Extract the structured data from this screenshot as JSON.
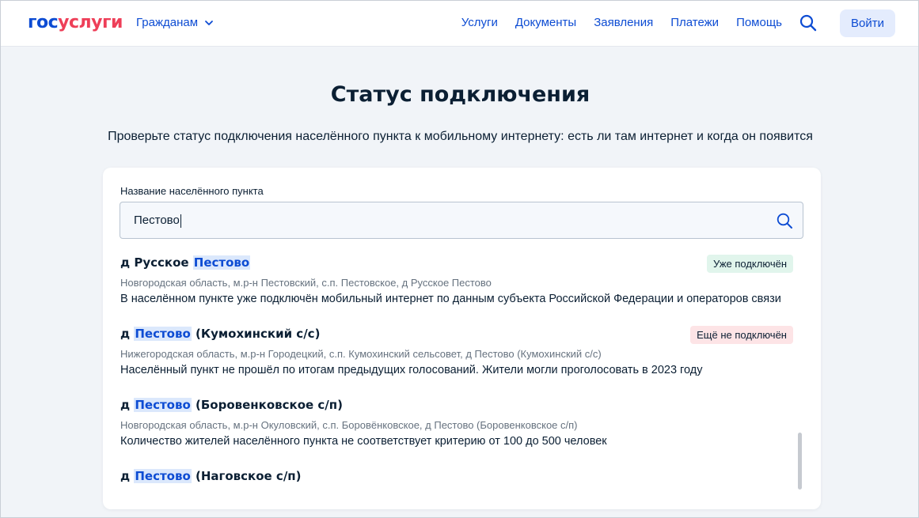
{
  "header": {
    "logo_part1": "гос",
    "logo_part2": "услуги",
    "role_select": "Гражданам",
    "nav": [
      "Услуги",
      "Документы",
      "Заявления",
      "Платежи",
      "Помощь"
    ],
    "login_label": "Войти"
  },
  "page": {
    "title": "Статус подключения",
    "subtitle": "Проверьте статус подключения населённого пункта к мобильному интернету: есть ли там интернет и когда он появится"
  },
  "search": {
    "label": "Название населённого пункта",
    "value": "Пестово"
  },
  "results": [
    {
      "prefix": "д Русское ",
      "highlight": "Пестово",
      "suffix": "",
      "address": "Новгородская область, м.р-н Пестовский, с.п. Пестовское, д Русское Пестово",
      "note": "В населённом пункте уже подключён мобильный интернет по данным субъекта Российской Федерации и операторов связи",
      "badge": "Уже подключён",
      "badge_type": "ok"
    },
    {
      "prefix": "д ",
      "highlight": "Пестово",
      "suffix": " (Кумохинский с/с)",
      "address": "Нижегородская область, м.р-н Городецкий, с.п. Кумохинский сельсовет, д Пестово (Кумохинский с/с)",
      "note": "Населённый пункт не прошёл по итогам предыдущих голосований. Жители могли проголосовать в 2023 году",
      "badge": "Ещё не подключён",
      "badge_type": "no"
    },
    {
      "prefix": "д ",
      "highlight": "Пестово",
      "suffix": " (Боровенковское с/п)",
      "address": "Новгородская область, м.р-н Окуловский, с.п. Боровёнковское, д Пестово (Боровенковское с/п)",
      "note": "Количество жителей населённого пункта не соответствует критерию от 100 до 500 человек",
      "badge": "",
      "badge_type": ""
    },
    {
      "prefix": "д ",
      "highlight": "Пестово",
      "suffix": " (Наговское с/п)",
      "address": "",
      "note": "",
      "badge": "",
      "badge_type": ""
    }
  ],
  "colors": {
    "brand_blue": "#0d4cd3",
    "brand_red": "#ee3f58",
    "badge_ok_bg": "#e1f5ec",
    "badge_no_bg": "#fde4e6",
    "page_bg": "#f1f4f8"
  }
}
